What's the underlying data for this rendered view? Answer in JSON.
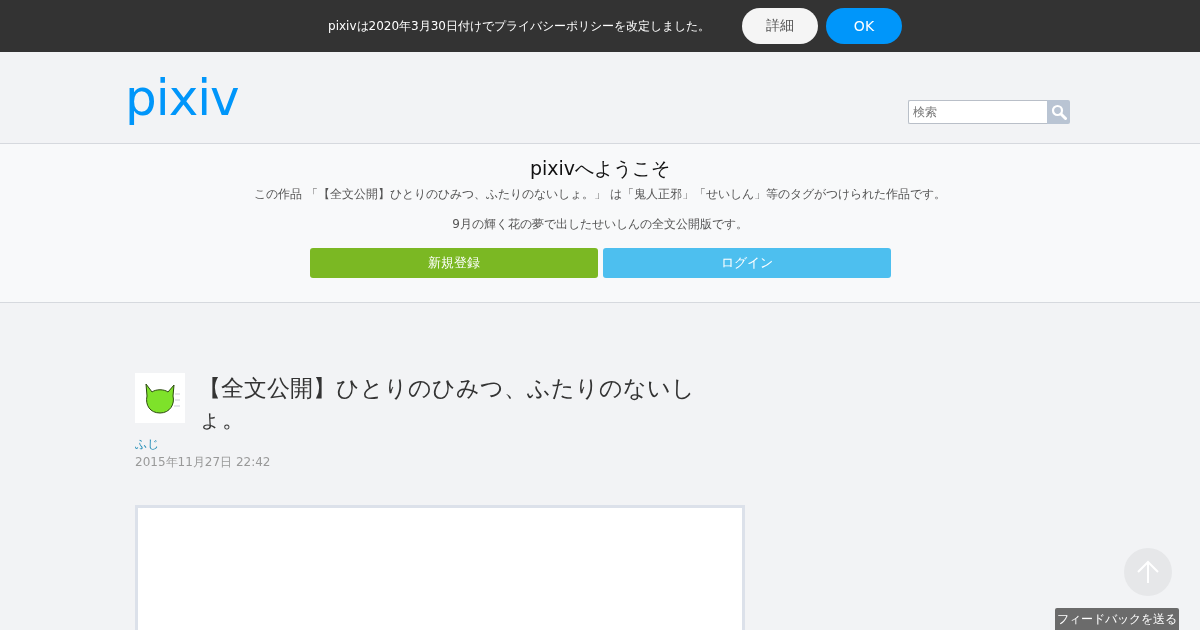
{
  "notice_bar": {
    "message": "pixivは2020年3月30日付けでプライバシーポリシーを改定しました。",
    "buttons": [
      {
        "label": "詳細",
        "kind": "secondary"
      },
      {
        "label": "OK",
        "kind": "primary"
      }
    ]
  },
  "header": {
    "logo": "pixiv",
    "search": {
      "placeholder": "検索"
    }
  },
  "welcome": {
    "title": "pixivへようこそ",
    "description": "この作品 「【全文公開】ひとりのひみつ、ふたりのないしょ。」 は「鬼人正邪」「せいしん」等のタグがつけられた作品です。",
    "caption": "9月の輝く花の夢で出したせいしんの全文公開版です。",
    "buttons": [
      {
        "label": "新規登録",
        "kind": "signup"
      },
      {
        "label": "ログイン",
        "kind": "login"
      }
    ]
  },
  "work": {
    "title": "【全文公開】ひとりのひみつ、ふたりのないしょ。",
    "author": "ふじ",
    "date": "2015年11月27日 22:42"
  },
  "feedback_button": "フィードバックを送る"
}
